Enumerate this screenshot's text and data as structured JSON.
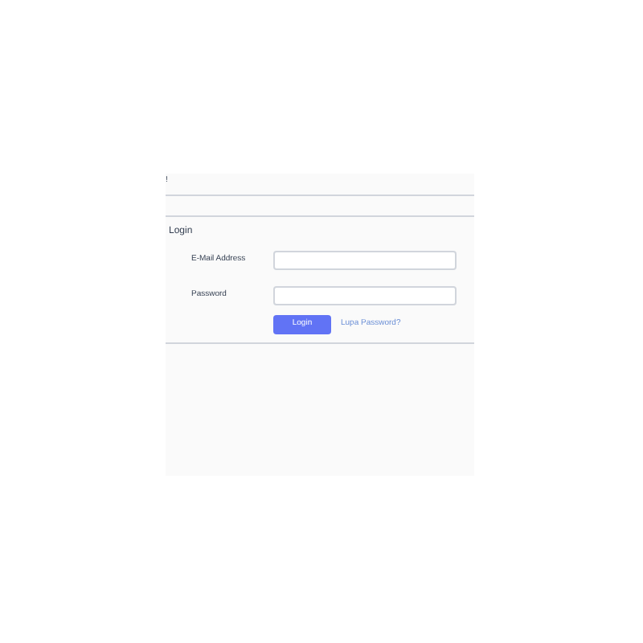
{
  "top_mark": "!",
  "card": {
    "header": "Login",
    "fields": [
      {
        "label": "E-Mail Address"
      },
      {
        "label": "Password"
      }
    ],
    "button": "Login",
    "link": "Lupa Password?"
  }
}
